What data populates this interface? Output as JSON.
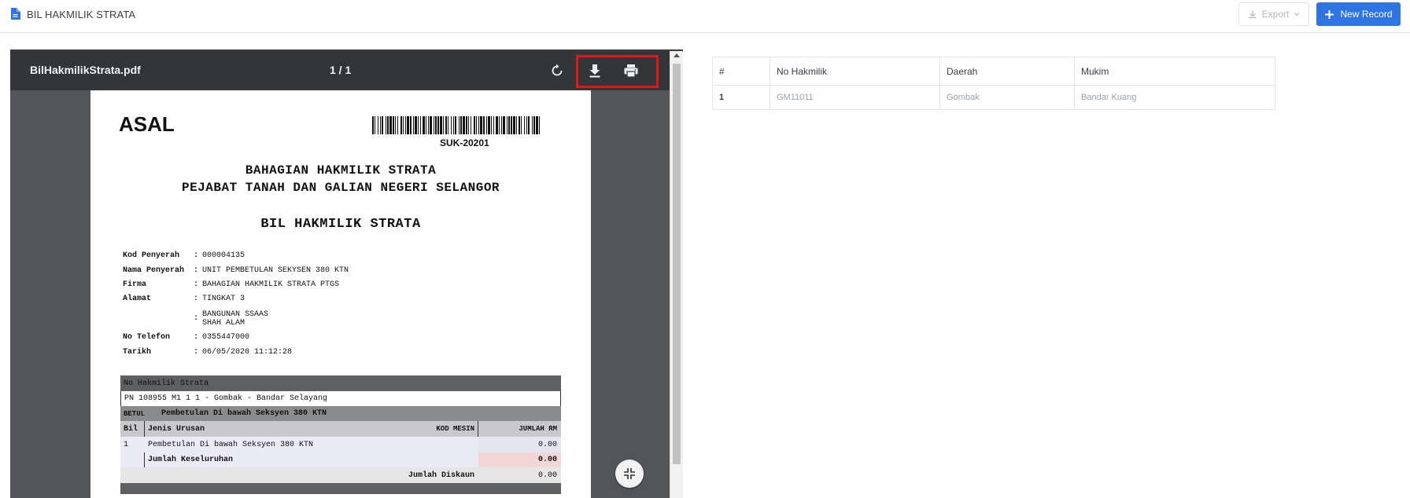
{
  "header": {
    "title": "BIL HAKMILIK STRATA",
    "export_label": "Export",
    "new_record_label": "New Record",
    "accent_color": "#2f74e4"
  },
  "viewer": {
    "filename": "BilHakmilikStrata.pdf",
    "page_indicator": "1 / 1",
    "icons": [
      "rotate-icon",
      "download-icon",
      "print-icon",
      "fit-page-icon"
    ]
  },
  "document": {
    "stamp": "ASAL",
    "barcode_text": "SUK-20201",
    "heading_line1": "BAHAGIAN HAKMILIK STRATA",
    "heading_line2": "PEJABAT TANAH DAN GALIAN NEGERI SELANGOR",
    "heading_main": "BIL HAKMILIK STRATA",
    "fields": {
      "kod_penyerah_label": "Kod Penyerah",
      "kod_penyerah": "000004135",
      "nama_penyerah_label": "Nama Penyerah",
      "nama_penyerah": "UNIT PEMBETULAN SEKYSEN 380 KTN",
      "firma_label": "Firma",
      "firma": "BAHAGIAN HAKMILIK STRATA PTGS",
      "alamat_label": "Alamat",
      "alamat1": "TINGKAT 3",
      "alamat2": "BANGUNAN SSAAS\nSHAH ALAM",
      "no_telefon_label": "No Telefon",
      "no_telefon": "0355447000",
      "tarikh_label": "Tarikh",
      "tarikh": "06/05/2020 11:12:28",
      "colon": ":"
    },
    "table": {
      "no_hakmilik_header": "No Hakmilik Strata",
      "no_hakmilik_value": "PN 108955 M1 1 1  - Gombak  - Bandar Selayang",
      "section_code": "BETUL",
      "section_desc": "Pembetulan Di bawah Seksyen 380 KTN",
      "col_bil": "Bil",
      "col_jenis": "Jenis Urusan",
      "col_kod": "KOD MESIN",
      "col_jumlah": "JUMLAH RM",
      "item_bil": "1",
      "item_desc": "Pembetulan Di bawah Seksyen 380 KTN",
      "item_amount": "0.00",
      "total_label": "Jumlah Keseluruhan",
      "total_amount": "0.00",
      "diskaun_label": "Jumlah Diskaun",
      "diskaun_amount": "0.00"
    }
  },
  "records_table": {
    "headers": [
      "#",
      "No Hakmilik",
      "Daerah",
      "Mukim"
    ],
    "rows": [
      [
        "1",
        "GM11011",
        "Gombak",
        "Bandar Kuang"
      ]
    ]
  }
}
